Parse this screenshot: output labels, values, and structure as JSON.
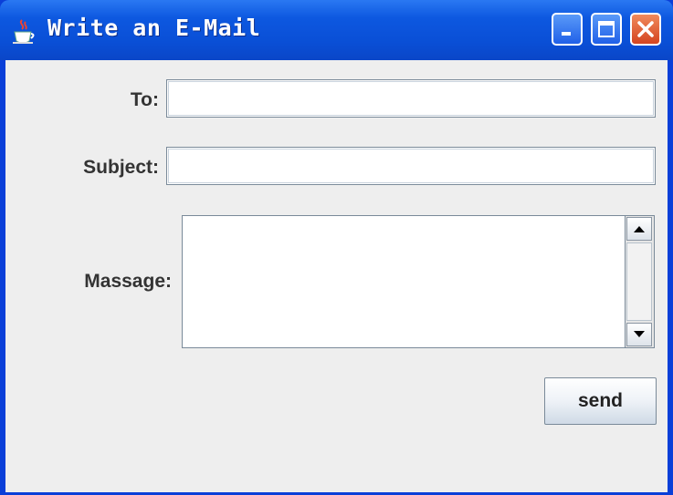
{
  "window": {
    "title": "Write an E-Mail",
    "icon": "java-cup-icon",
    "controls": {
      "minimize": "minimize-icon",
      "maximize": "maximize-icon",
      "close": "close-icon"
    }
  },
  "form": {
    "to": {
      "label": "To:",
      "value": ""
    },
    "subject": {
      "label": "Subject:",
      "value": ""
    },
    "message": {
      "label": "Massage:",
      "value": ""
    },
    "send_label": "send"
  },
  "colors": {
    "titlebar": "#0a4fd6",
    "client_bg": "#eeeeee",
    "close_button": "#d44420"
  }
}
